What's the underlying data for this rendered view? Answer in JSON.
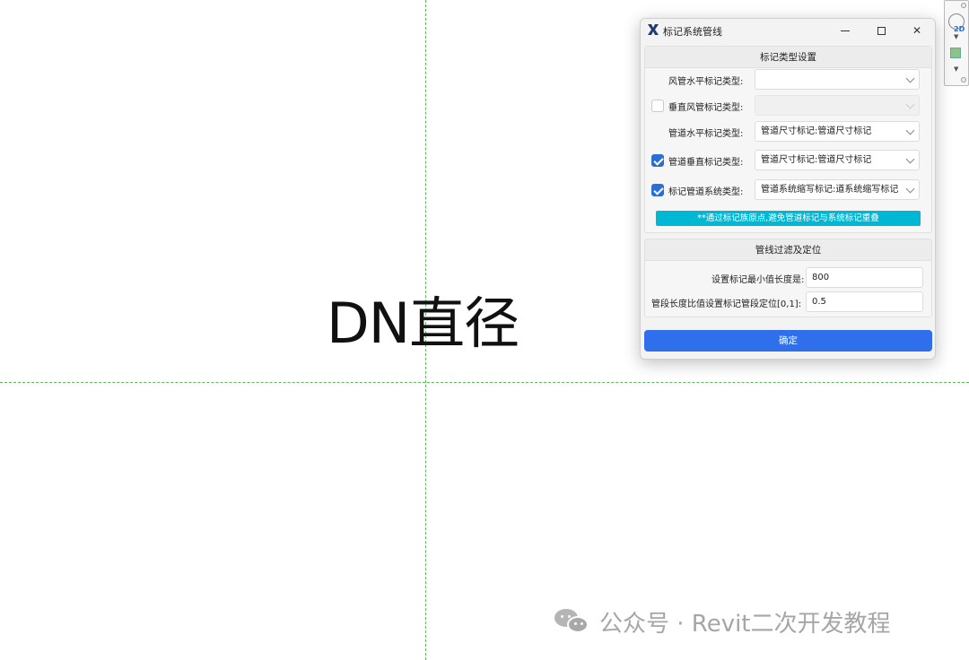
{
  "canvas": {
    "main_label": "DN直径",
    "guide_color": "#5cb85c"
  },
  "navwidget": {
    "label_2d": "2D",
    "icons": [
      "steering-wheel-icon",
      "zoom-icon"
    ]
  },
  "dialog": {
    "title": "标记系统管线",
    "icon": "revit-x-icon",
    "controls": {
      "minimize": "minimize-icon",
      "maximize": "maximize-icon",
      "close": "close-icon"
    },
    "group1": {
      "header": "标记类型设置",
      "rows": [
        {
          "label": "风管水平标记类型:",
          "has_checkbox": false,
          "checked": false,
          "value": "",
          "enabled": true
        },
        {
          "label": "垂直风管标记类型:",
          "has_checkbox": true,
          "checked": false,
          "value": "",
          "enabled": false
        },
        {
          "label": "管道水平标记类型:",
          "has_checkbox": false,
          "checked": false,
          "value": "管道尺寸标记:管道尺寸标记",
          "enabled": true
        },
        {
          "label": "管道垂直标记类型:",
          "has_checkbox": true,
          "checked": true,
          "value": "管道尺寸标记:管道尺寸标记",
          "enabled": true
        },
        {
          "label": "标记管道系统类型:",
          "has_checkbox": true,
          "checked": true,
          "value": "管道系统缩写标记:道系统缩写标记",
          "enabled": true
        }
      ],
      "info": "**通过标记族原点,避免管道标记与系统标记重叠",
      "info_color": "#00b8d4"
    },
    "group2": {
      "header": "管线过滤及定位",
      "fields": [
        {
          "label": "设置标记最小值长度是:",
          "value": "800"
        },
        {
          "label": "管段长度比值设置标记管段定位[0,1]:",
          "value": "0.5"
        }
      ]
    },
    "ok_button": {
      "label": "确定",
      "color": "#2f6fec"
    }
  },
  "watermark": {
    "text": "公众号 · Revit二次开发教程",
    "icon": "wechat-icon"
  }
}
